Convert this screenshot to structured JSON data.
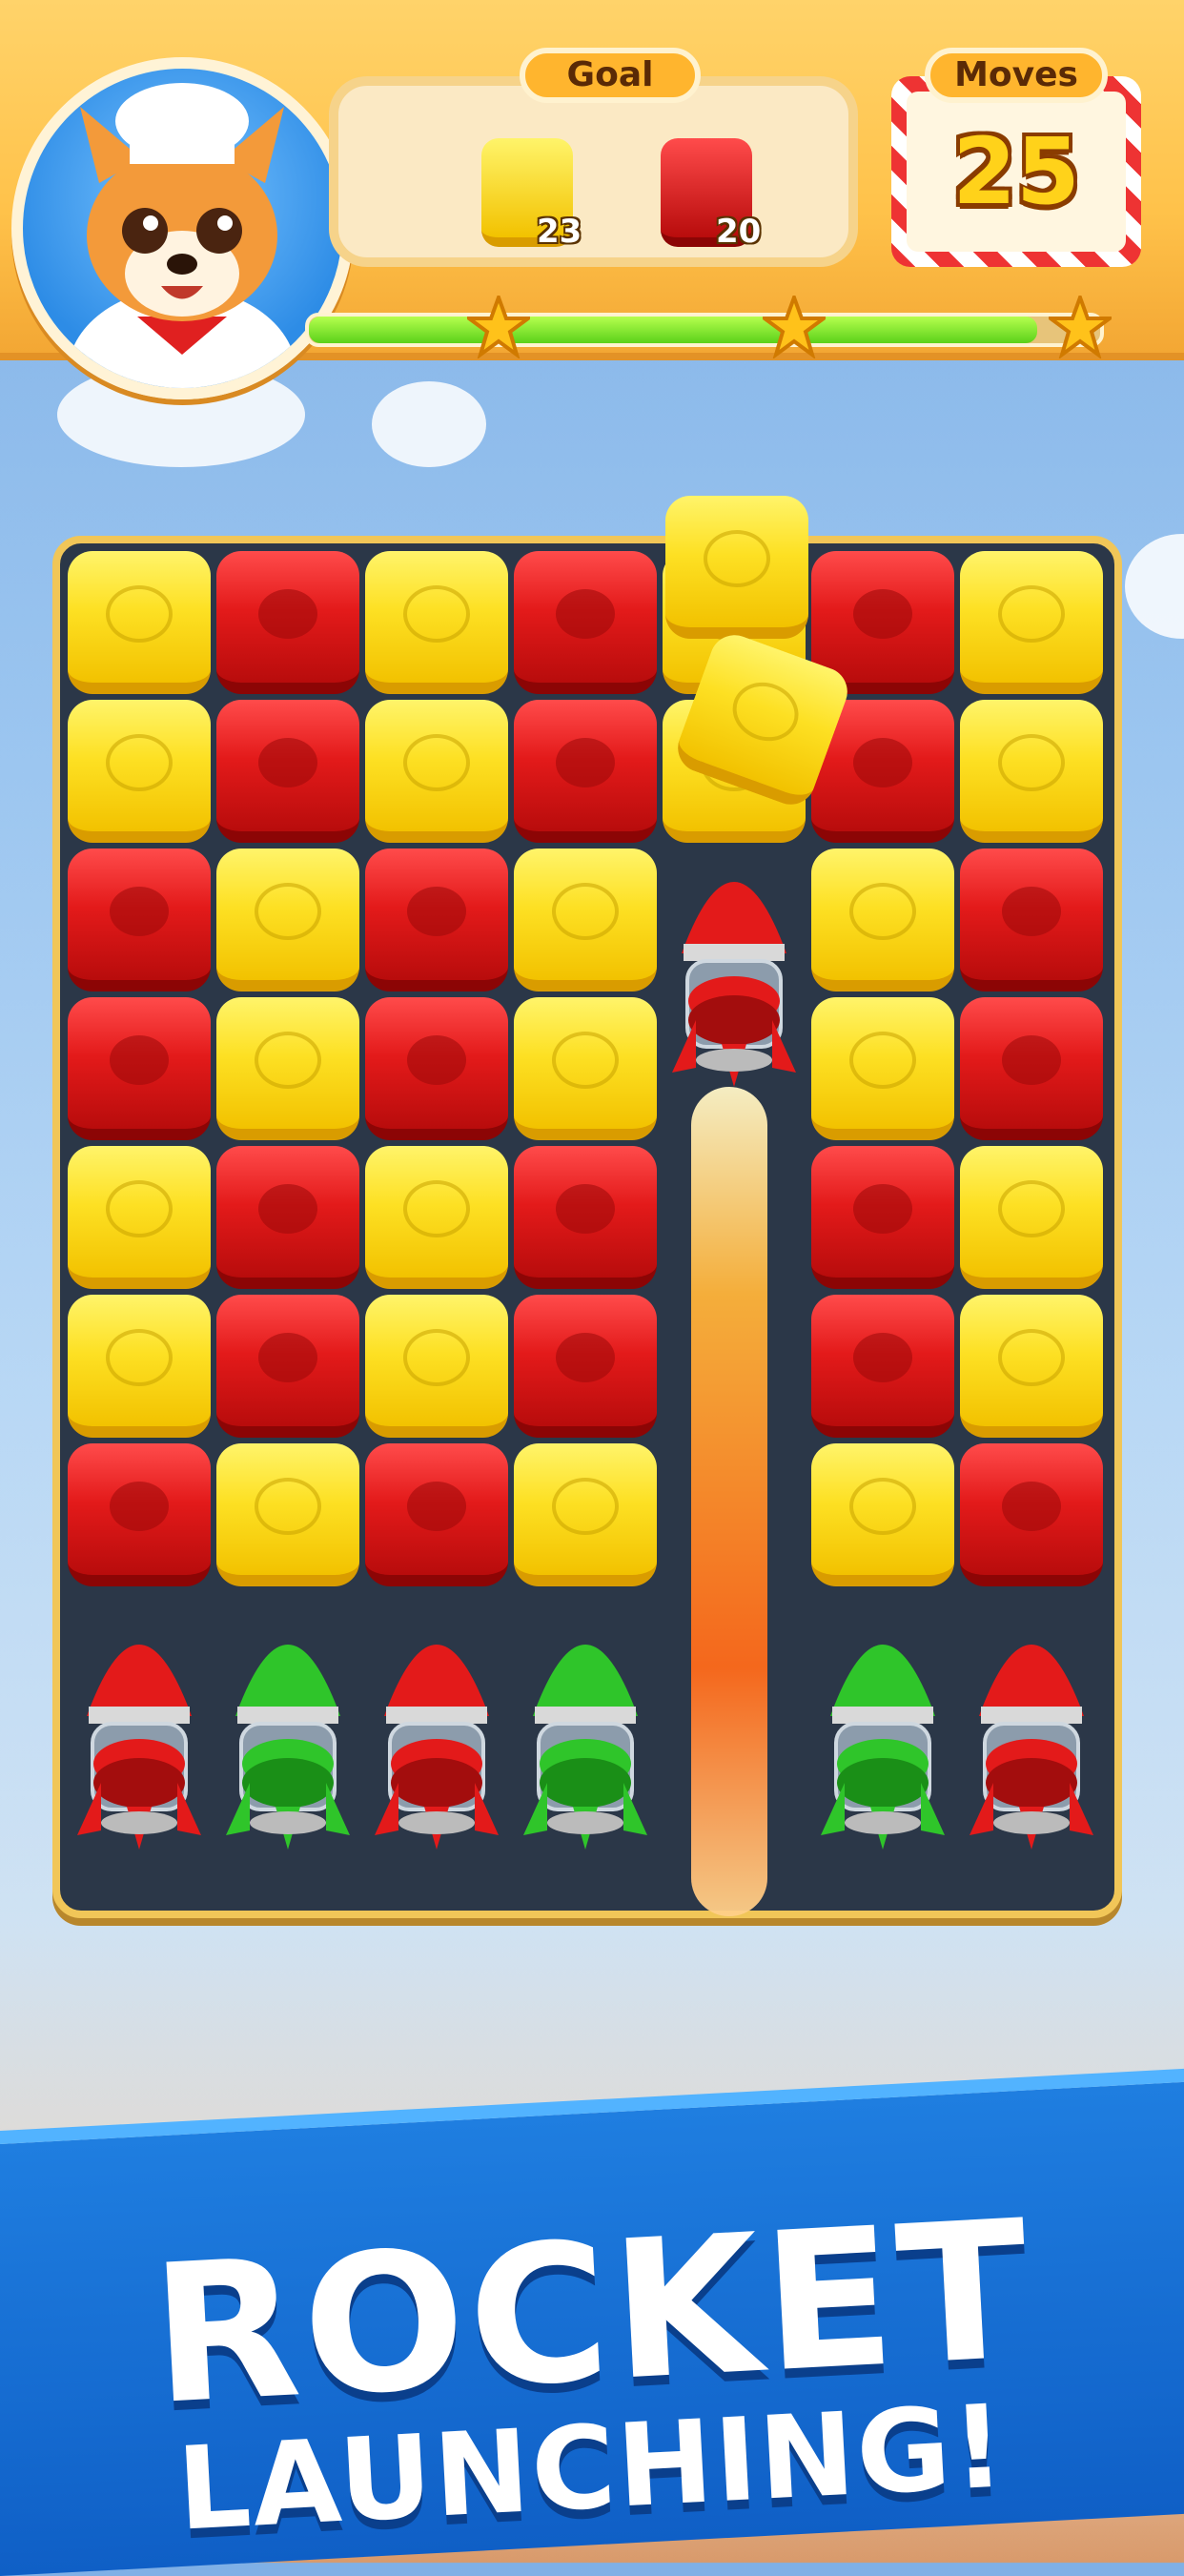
{
  "colors": {
    "yellow": "#fde023",
    "red": "#e31a1a",
    "green": "#2fc52a",
    "board": "#2b3748",
    "banner": "#1f7ee0"
  },
  "header": {
    "goal_label": "Goal",
    "goals": [
      {
        "color": "yellow",
        "count": "23"
      },
      {
        "color": "red",
        "count": "20"
      }
    ],
    "moves_label": "Moves",
    "moves_value": "25",
    "progress_fraction": 0.92,
    "stars": 3
  },
  "board": {
    "columns": 7,
    "rows": [
      [
        "yellow",
        "red",
        "yellow",
        "red",
        "yellow",
        "red",
        "yellow"
      ],
      [
        "yellow",
        "red",
        "yellow",
        "red",
        "yellow",
        "red",
        "yellow"
      ],
      [
        "red",
        "yellow",
        "red",
        "yellow",
        "rocket-red",
        "yellow",
        "red"
      ],
      [
        "red",
        "yellow",
        "red",
        "yellow",
        "",
        "yellow",
        "red"
      ],
      [
        "yellow",
        "red",
        "yellow",
        "red",
        "",
        "red",
        "yellow"
      ],
      [
        "yellow",
        "red",
        "yellow",
        "red",
        "",
        "red",
        "yellow"
      ],
      [
        "red",
        "yellow",
        "red",
        "yellow",
        "",
        "yellow",
        "red"
      ],
      [
        "rocket-red",
        "rocket-green",
        "rocket-red",
        "rocket-green",
        "",
        "rocket-green",
        "rocket-red"
      ]
    ]
  },
  "banner": {
    "line1": "ROCKET",
    "line2": "LAUNCHING!"
  }
}
